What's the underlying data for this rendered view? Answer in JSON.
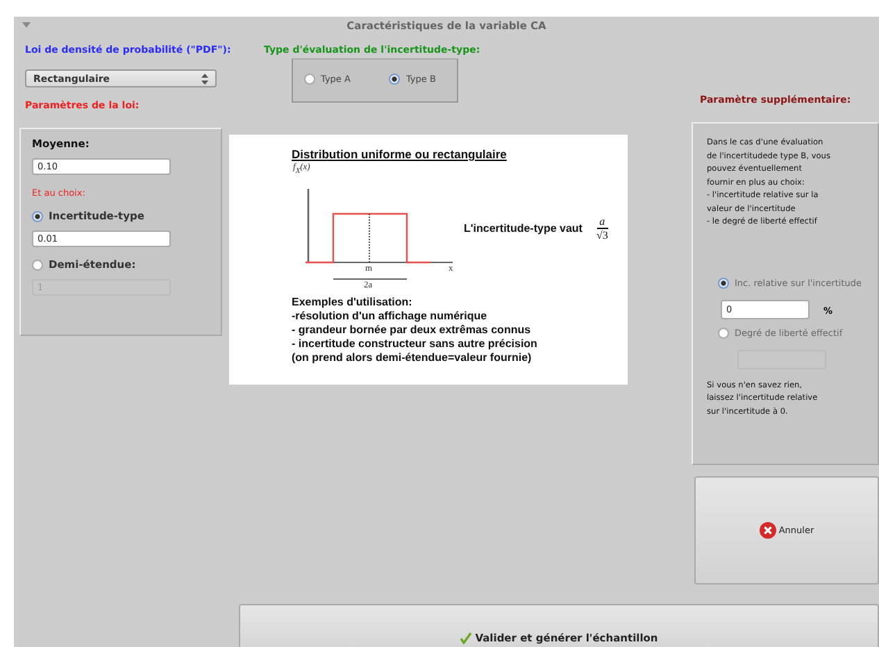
{
  "window": {
    "title": "Caractéristiques de la variable CA"
  },
  "pdf": {
    "label": "Loi de densité de probabilité (\"PDF\"):",
    "value": "Rectangulaire"
  },
  "law_params": {
    "label": "Paramètres de la loi:",
    "mean_label": "Moyenne:",
    "mean_value": "0.10",
    "choice_label": "Et au choix:",
    "options": [
      {
        "label": "Incertitude-type",
        "selected": true,
        "value": "0.01"
      },
      {
        "label": "Demi-étendue:",
        "selected": false,
        "value": "1"
      }
    ]
  },
  "evaluation_type": {
    "label": "Type d'évaluation de l'incertitude-type:",
    "options": [
      {
        "label": "Type A",
        "selected": false
      },
      {
        "label": "Type B",
        "selected": true
      }
    ]
  },
  "illustration": {
    "title": "Distribution uniforme ou rectangulaire",
    "y_label": "f$_{X}$(x)",
    "x_label": "x",
    "center_label": "m",
    "width_label": "2a",
    "formula_label": "L'incertitude-type vaut",
    "formula_numerator": "a",
    "formula_denominator": "√3",
    "examples_title": "Exemples d'utilisation:",
    "examples": [
      "-résolution d'un affichage numérique",
      "- grandeur bornée par deux extrêmas connus",
      "- incertitude constructeur sans autre précision",
      "(on prend alors demi-étendue=valeur fournie)"
    ]
  },
  "supplementary": {
    "label": "Paramètre supplémentaire:",
    "description": "Dans le cas d'une évaluation\nde l'incertitudede type B, vous\npouvez éventuellement\nfournir en plus au choix:\n- l'incertitude relative sur la\nvaleur de l'incertitude\n- le degré de liberté effectif",
    "options": [
      {
        "label": "Inc. relative sur l'incertitude",
        "selected": true,
        "value": "0",
        "unit": "%"
      },
      {
        "label": "Degré de liberté effectif",
        "selected": false
      }
    ],
    "note": "Si vous n'en savez rien,\nlaissez l'incertitude relative\nsur l'incertitude à 0."
  },
  "buttons": [
    {
      "label": "Annuler",
      "kind": "cancel"
    },
    {
      "label": "Valider et générer l'échantillon",
      "kind": "validate"
    }
  ]
}
